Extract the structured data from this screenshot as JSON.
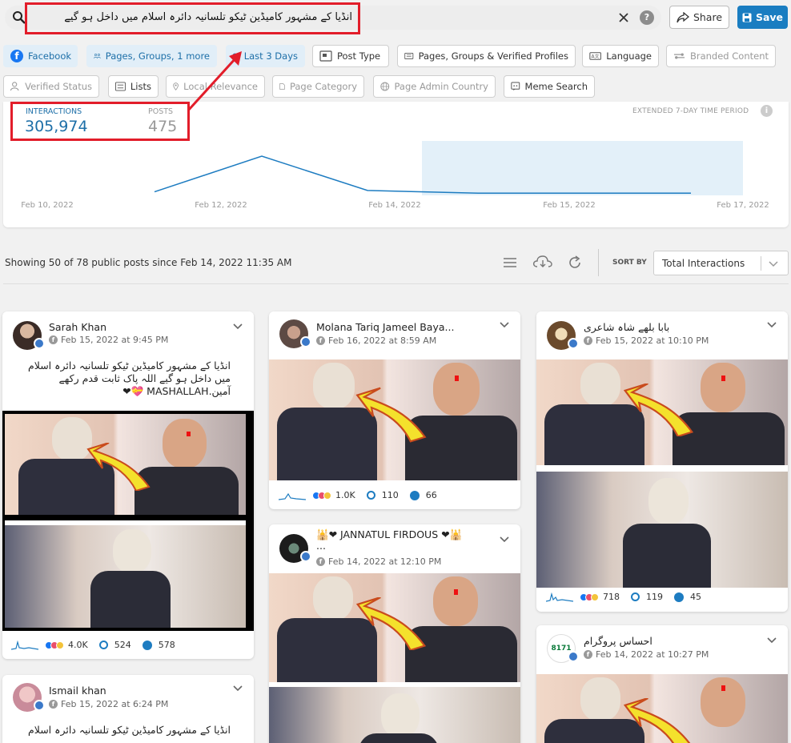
{
  "search": {
    "query": "انڈیا کے مشہور کامیڈین ٹیکو تلسانیہ دائرہ اسلام میں داخل ہو گیے"
  },
  "header": {
    "share_label": "Share",
    "save_label": "Save"
  },
  "filters": {
    "facebook": "Facebook",
    "pages_groups": "Pages, Groups, 1 more",
    "last_days": "Last 3 Days",
    "post_type": "Post Type",
    "pgv": "Pages, Groups & Verified Profiles",
    "language": "Language",
    "branded": "Branded Content",
    "verified": "Verified Status",
    "lists": "Lists",
    "local": "Local Relevance",
    "page_cat": "Page Category",
    "admin_country": "Page Admin Country",
    "meme": "Meme Search"
  },
  "summary": {
    "interactions_label": "INTERACTIONS",
    "interactions_value": "305,974",
    "posts_label": "POSTS",
    "posts_value": "475",
    "extended_label": "EXTENDED 7-DAY TIME PERIOD"
  },
  "chart_data": {
    "type": "line",
    "x": [
      "Feb 10, 2022",
      "Feb 12, 2022",
      "Feb 14, 2022",
      "Feb 15, 2022",
      "Feb 17, 2022"
    ],
    "series": [
      {
        "values": [
          2,
          28,
          3,
          1,
          1
        ]
      }
    ],
    "highlight_range": [
      "Feb 14, 2022",
      "Feb 17, 2022"
    ]
  },
  "toolbar": {
    "showing": "Showing 50 of 78 public posts since Feb 14, 2022 11:35 AM",
    "sort_by": "SORT BY",
    "sort_value": "Total Interactions"
  },
  "posts": [
    {
      "name": "Sarah Khan",
      "date": "Feb 15, 2022 at 9:45 PM",
      "text": "انڈیا کے مشہور کامیڈین ٹیکو تلسانیہ دائرہ اسلام میں داخل ہو گیے اللہ پاک ثابت قدم رکھے آمین.MASHALLAH 💝❤",
      "reactions": "4.0K",
      "comments": "524",
      "shares": "578"
    },
    {
      "name": "Ismail khan",
      "date": "Feb 15, 2022 at 6:24 PM",
      "text": "انڈیا کے مشہور کامیڈین ٹیکو تلسانیہ دائرہ اسلام"
    },
    {
      "name": "Molana Tariq Jameel Baya...",
      "date": "Feb 16, 2022 at 8:59 AM",
      "reactions": "1.0K",
      "comments": "110",
      "shares": "66"
    },
    {
      "name": "🕌❤ JANNATUL FIRDOUS ❤🕌",
      "name2": "...",
      "date": "Feb 14, 2022 at 12:10 PM"
    },
    {
      "name": "بابا بلھے شاہ شاعری",
      "date": "Feb 15, 2022 at 10:10 PM",
      "reactions": "718",
      "comments": "119",
      "shares": "45"
    },
    {
      "name": "احساس پروگرام",
      "date": "Feb 14, 2022 at 10:27 PM",
      "avatar_text": "8171"
    }
  ]
}
